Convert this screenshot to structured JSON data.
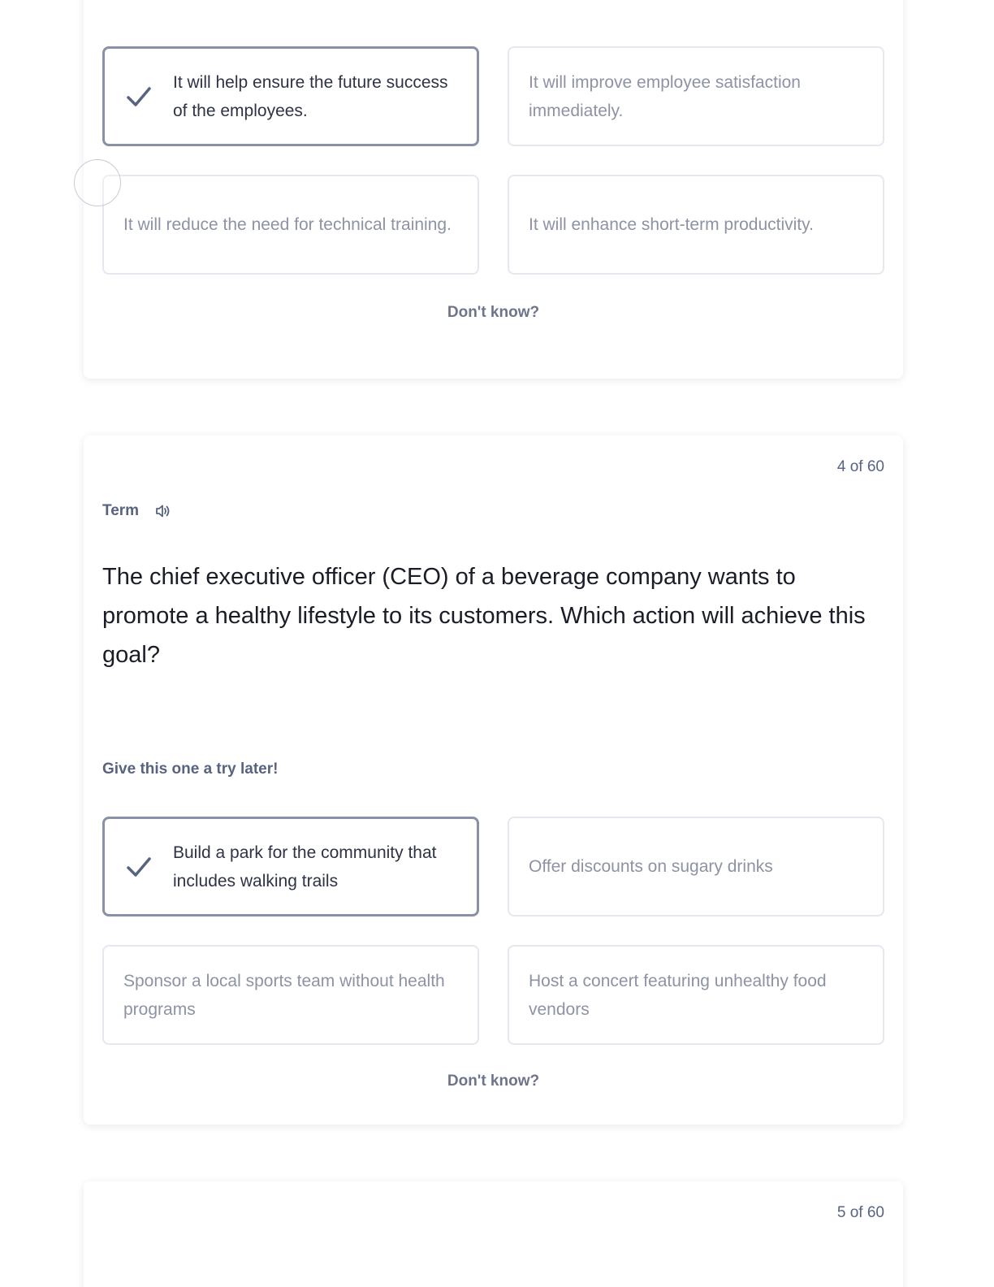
{
  "previous_question": {
    "options": [
      {
        "text": "It will help ensure the future success of the employees.",
        "selected": true
      },
      {
        "text": "It will improve employee satisfaction immediately.",
        "selected": false
      },
      {
        "text": "It will reduce the need for technical training.",
        "selected": false
      },
      {
        "text": "It will enhance short-term productivity.",
        "selected": false
      }
    ],
    "dont_know": "Don't know?"
  },
  "current_question": {
    "counter": "4 of 60",
    "term_label": "Term",
    "speaker_icon": "speaker-icon",
    "prompt": "The chief executive officer (CEO) of a beverage company wants to promote a healthy lifestyle to its customers. Which action will achieve this goal?",
    "feedback": "Give this one a try later!",
    "options": [
      {
        "text": "Build a park for the community that includes walking trails",
        "selected": true
      },
      {
        "text": "Offer discounts on sugary drinks",
        "selected": false
      },
      {
        "text": "Sponsor a local sports team without health programs",
        "selected": false
      },
      {
        "text": "Host a concert featuring unhealthy food vendors",
        "selected": false
      }
    ],
    "dont_know": "Don't know?"
  },
  "next_question": {
    "counter": "5 of 60"
  },
  "colors": {
    "selected_border": "#8a90a5",
    "unselected_border": "#e6e8ef",
    "muted_text": "#8d93a5",
    "label_text": "#586380"
  }
}
